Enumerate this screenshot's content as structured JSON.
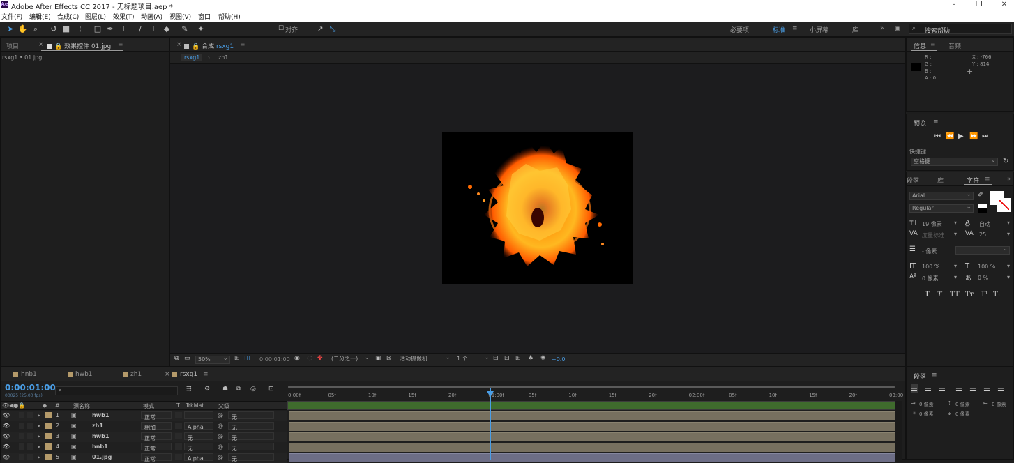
{
  "window": {
    "title": "Adobe After Effects CC 2017 - 无标题项目.aep *",
    "logo": "Ae"
  },
  "menu": [
    "文件(F)",
    "编辑(E)",
    "合成(C)",
    "图层(L)",
    "效果(T)",
    "动画(A)",
    "视图(V)",
    "窗口",
    "帮助(H)"
  ],
  "toolbar": {
    "align_label": "对齐",
    "workspaces": [
      "必要项",
      "标准",
      "小屏幕",
      "库"
    ],
    "search_placeholder": "搜索帮助"
  },
  "left_panel": {
    "tabs": [
      "项目",
      "效果控件 01.jpg"
    ],
    "breadcrumb": "rsxg1 • 01.jpg"
  },
  "comp_panel": {
    "tab": "合成",
    "tab_name": "rsxg1",
    "crumbs": [
      "rsxg1",
      "zh1"
    ],
    "zoom": "50%",
    "timecode": "0:00:01:00",
    "resolution": "(二分之一)",
    "camera": "活动摄像机",
    "views": "1 个...",
    "exposure": "+0.0"
  },
  "info_panel": {
    "tabs": [
      "信息",
      "音频"
    ],
    "r": "R :",
    "g": "G :",
    "b": "B :",
    "a": "A : 0",
    "x": "X : -766",
    "y": "Y : 814"
  },
  "preview_panel": {
    "title": "预览",
    "shortcut_label": "快捷键",
    "shortcut_value": "空格键"
  },
  "char_panel": {
    "tabs": [
      "段落",
      "库",
      "字符"
    ],
    "font": "Arial",
    "style": "Regular",
    "size": "19 像素",
    "leading": "自动",
    "kerning": "度量标准",
    "tracking": "25",
    "stroke": "- 像素",
    "vscale": "100 %",
    "hscale": "100 %",
    "baseline": "0 像素",
    "tsume": "0 %",
    "styles": [
      "T",
      "T",
      "TT",
      "Tт",
      "T¹",
      "T₁"
    ]
  },
  "para_panel": {
    "title": "段落",
    "indent": [
      "0 像素",
      "0 像素",
      "0 像素",
      "0 像素",
      "0 像素"
    ]
  },
  "timeline": {
    "tabs": [
      "hnb1",
      "hwb1",
      "zh1",
      "rsxg1"
    ],
    "timecode": "0:00:01:00",
    "frames": "00025 (25.00 fps)",
    "columns": [
      "源名称",
      "模式",
      "T",
      "TrkMat",
      "父级"
    ],
    "ruler": [
      "0:00f",
      "05f",
      "10f",
      "15f",
      "20f",
      "01:00f",
      "05f",
      "10f",
      "15f",
      "20f",
      "02:00f",
      "05f",
      "10f",
      "15f",
      "20f",
      "03:00"
    ],
    "layers": [
      {
        "num": "1",
        "name": "hwb1",
        "mode": "正常",
        "trk": "",
        "parent": "无"
      },
      {
        "num": "2",
        "name": "zh1",
        "mode": "相加",
        "trk": "Alpha",
        "parent": "无"
      },
      {
        "num": "3",
        "name": "hwb1",
        "mode": "正常",
        "trk": "无",
        "parent": "无"
      },
      {
        "num": "4",
        "name": "hnb1",
        "mode": "正常",
        "trk": "无",
        "parent": "无"
      },
      {
        "num": "5",
        "name": "01.jpg",
        "mode": "正常",
        "trk": "Alpha",
        "parent": "无"
      }
    ]
  }
}
